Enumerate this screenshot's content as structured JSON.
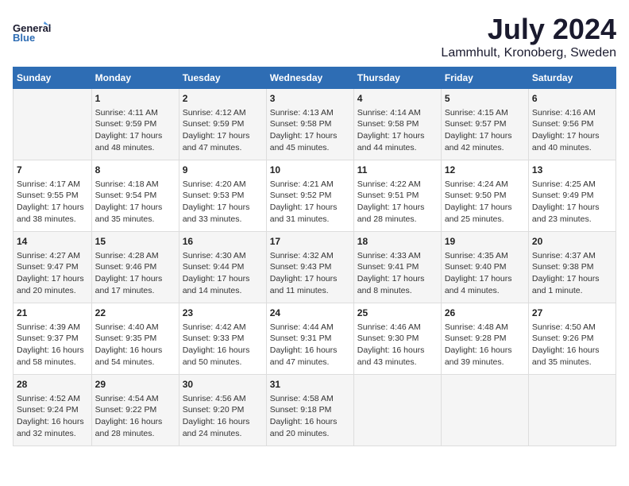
{
  "header": {
    "logo_general": "General",
    "logo_blue": "Blue",
    "month_year": "July 2024",
    "location": "Lammhult, Kronoberg, Sweden"
  },
  "days_of_week": [
    "Sunday",
    "Monday",
    "Tuesday",
    "Wednesday",
    "Thursday",
    "Friday",
    "Saturday"
  ],
  "weeks": [
    [
      {
        "day": "",
        "content": ""
      },
      {
        "day": "1",
        "content": "Sunrise: 4:11 AM\nSunset: 9:59 PM\nDaylight: 17 hours\nand 48 minutes."
      },
      {
        "day": "2",
        "content": "Sunrise: 4:12 AM\nSunset: 9:59 PM\nDaylight: 17 hours\nand 47 minutes."
      },
      {
        "day": "3",
        "content": "Sunrise: 4:13 AM\nSunset: 9:58 PM\nDaylight: 17 hours\nand 45 minutes."
      },
      {
        "day": "4",
        "content": "Sunrise: 4:14 AM\nSunset: 9:58 PM\nDaylight: 17 hours\nand 44 minutes."
      },
      {
        "day": "5",
        "content": "Sunrise: 4:15 AM\nSunset: 9:57 PM\nDaylight: 17 hours\nand 42 minutes."
      },
      {
        "day": "6",
        "content": "Sunrise: 4:16 AM\nSunset: 9:56 PM\nDaylight: 17 hours\nand 40 minutes."
      }
    ],
    [
      {
        "day": "7",
        "content": "Sunrise: 4:17 AM\nSunset: 9:55 PM\nDaylight: 17 hours\nand 38 minutes."
      },
      {
        "day": "8",
        "content": "Sunrise: 4:18 AM\nSunset: 9:54 PM\nDaylight: 17 hours\nand 35 minutes."
      },
      {
        "day": "9",
        "content": "Sunrise: 4:20 AM\nSunset: 9:53 PM\nDaylight: 17 hours\nand 33 minutes."
      },
      {
        "day": "10",
        "content": "Sunrise: 4:21 AM\nSunset: 9:52 PM\nDaylight: 17 hours\nand 31 minutes."
      },
      {
        "day": "11",
        "content": "Sunrise: 4:22 AM\nSunset: 9:51 PM\nDaylight: 17 hours\nand 28 minutes."
      },
      {
        "day": "12",
        "content": "Sunrise: 4:24 AM\nSunset: 9:50 PM\nDaylight: 17 hours\nand 25 minutes."
      },
      {
        "day": "13",
        "content": "Sunrise: 4:25 AM\nSunset: 9:49 PM\nDaylight: 17 hours\nand 23 minutes."
      }
    ],
    [
      {
        "day": "14",
        "content": "Sunrise: 4:27 AM\nSunset: 9:47 PM\nDaylight: 17 hours\nand 20 minutes."
      },
      {
        "day": "15",
        "content": "Sunrise: 4:28 AM\nSunset: 9:46 PM\nDaylight: 17 hours\nand 17 minutes."
      },
      {
        "day": "16",
        "content": "Sunrise: 4:30 AM\nSunset: 9:44 PM\nDaylight: 17 hours\nand 14 minutes."
      },
      {
        "day": "17",
        "content": "Sunrise: 4:32 AM\nSunset: 9:43 PM\nDaylight: 17 hours\nand 11 minutes."
      },
      {
        "day": "18",
        "content": "Sunrise: 4:33 AM\nSunset: 9:41 PM\nDaylight: 17 hours\nand 8 minutes."
      },
      {
        "day": "19",
        "content": "Sunrise: 4:35 AM\nSunset: 9:40 PM\nDaylight: 17 hours\nand 4 minutes."
      },
      {
        "day": "20",
        "content": "Sunrise: 4:37 AM\nSunset: 9:38 PM\nDaylight: 17 hours\nand 1 minute."
      }
    ],
    [
      {
        "day": "21",
        "content": "Sunrise: 4:39 AM\nSunset: 9:37 PM\nDaylight: 16 hours\nand 58 minutes."
      },
      {
        "day": "22",
        "content": "Sunrise: 4:40 AM\nSunset: 9:35 PM\nDaylight: 16 hours\nand 54 minutes."
      },
      {
        "day": "23",
        "content": "Sunrise: 4:42 AM\nSunset: 9:33 PM\nDaylight: 16 hours\nand 50 minutes."
      },
      {
        "day": "24",
        "content": "Sunrise: 4:44 AM\nSunset: 9:31 PM\nDaylight: 16 hours\nand 47 minutes."
      },
      {
        "day": "25",
        "content": "Sunrise: 4:46 AM\nSunset: 9:30 PM\nDaylight: 16 hours\nand 43 minutes."
      },
      {
        "day": "26",
        "content": "Sunrise: 4:48 AM\nSunset: 9:28 PM\nDaylight: 16 hours\nand 39 minutes."
      },
      {
        "day": "27",
        "content": "Sunrise: 4:50 AM\nSunset: 9:26 PM\nDaylight: 16 hours\nand 35 minutes."
      }
    ],
    [
      {
        "day": "28",
        "content": "Sunrise: 4:52 AM\nSunset: 9:24 PM\nDaylight: 16 hours\nand 32 minutes."
      },
      {
        "day": "29",
        "content": "Sunrise: 4:54 AM\nSunset: 9:22 PM\nDaylight: 16 hours\nand 28 minutes."
      },
      {
        "day": "30",
        "content": "Sunrise: 4:56 AM\nSunset: 9:20 PM\nDaylight: 16 hours\nand 24 minutes."
      },
      {
        "day": "31",
        "content": "Sunrise: 4:58 AM\nSunset: 9:18 PM\nDaylight: 16 hours\nand 20 minutes."
      },
      {
        "day": "",
        "content": ""
      },
      {
        "day": "",
        "content": ""
      },
      {
        "day": "",
        "content": ""
      }
    ]
  ]
}
